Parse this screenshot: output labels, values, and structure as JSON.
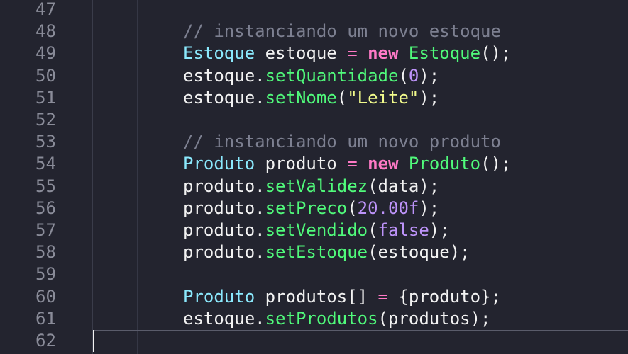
{
  "lines": [
    {
      "n": "47",
      "tokens": []
    },
    {
      "n": "48",
      "tokens": [
        {
          "t": "cmt",
          "v": "// instanciando um novo estoque"
        }
      ]
    },
    {
      "n": "49",
      "tokens": [
        {
          "t": "type",
          "v": "Estoque"
        },
        {
          "t": "plain",
          "v": " estoque "
        },
        {
          "t": "op",
          "v": "="
        },
        {
          "t": "plain",
          "v": " "
        },
        {
          "t": "kw",
          "v": "new"
        },
        {
          "t": "plain",
          "v": " "
        },
        {
          "t": "fn",
          "v": "Estoque"
        },
        {
          "t": "plain",
          "v": "();"
        }
      ]
    },
    {
      "n": "50",
      "tokens": [
        {
          "t": "plain",
          "v": "estoque."
        },
        {
          "t": "fn",
          "v": "setQuantidade"
        },
        {
          "t": "plain",
          "v": "("
        },
        {
          "t": "num",
          "v": "0"
        },
        {
          "t": "plain",
          "v": ");"
        }
      ]
    },
    {
      "n": "51",
      "tokens": [
        {
          "t": "plain",
          "v": "estoque."
        },
        {
          "t": "fn",
          "v": "setNome"
        },
        {
          "t": "plain",
          "v": "("
        },
        {
          "t": "str",
          "v": "\"Leite\""
        },
        {
          "t": "plain",
          "v": ");"
        }
      ]
    },
    {
      "n": "52",
      "tokens": []
    },
    {
      "n": "53",
      "tokens": [
        {
          "t": "cmt",
          "v": "// instanciando um novo produto"
        }
      ]
    },
    {
      "n": "54",
      "tokens": [
        {
          "t": "type",
          "v": "Produto"
        },
        {
          "t": "plain",
          "v": " produto "
        },
        {
          "t": "op",
          "v": "="
        },
        {
          "t": "plain",
          "v": " "
        },
        {
          "t": "kw",
          "v": "new"
        },
        {
          "t": "plain",
          "v": " "
        },
        {
          "t": "fn",
          "v": "Produto"
        },
        {
          "t": "plain",
          "v": "();"
        }
      ]
    },
    {
      "n": "55",
      "tokens": [
        {
          "t": "plain",
          "v": "produto."
        },
        {
          "t": "fn",
          "v": "setValidez"
        },
        {
          "t": "plain",
          "v": "(data);"
        }
      ]
    },
    {
      "n": "56",
      "tokens": [
        {
          "t": "plain",
          "v": "produto."
        },
        {
          "t": "fn",
          "v": "setPreco"
        },
        {
          "t": "plain",
          "v": "("
        },
        {
          "t": "num",
          "v": "20.00f"
        },
        {
          "t": "plain",
          "v": ");"
        }
      ]
    },
    {
      "n": "57",
      "tokens": [
        {
          "t": "plain",
          "v": "produto."
        },
        {
          "t": "fn",
          "v": "setVendido"
        },
        {
          "t": "plain",
          "v": "("
        },
        {
          "t": "num",
          "v": "false"
        },
        {
          "t": "plain",
          "v": ");"
        }
      ]
    },
    {
      "n": "58",
      "tokens": [
        {
          "t": "plain",
          "v": "produto."
        },
        {
          "t": "fn",
          "v": "setEstoque"
        },
        {
          "t": "plain",
          "v": "(estoque);"
        }
      ]
    },
    {
      "n": "59",
      "tokens": []
    },
    {
      "n": "60",
      "tokens": [
        {
          "t": "type",
          "v": "Produto"
        },
        {
          "t": "plain",
          "v": " produtos[] "
        },
        {
          "t": "op",
          "v": "="
        },
        {
          "t": "plain",
          "v": " {produto};"
        }
      ]
    },
    {
      "n": "61",
      "tokens": [
        {
          "t": "plain",
          "v": "estoque."
        },
        {
          "t": "fn",
          "v": "setProdutos"
        },
        {
          "t": "plain",
          "v": "(produtos);"
        }
      ]
    },
    {
      "n": "62",
      "tokens": [],
      "current": true
    }
  ],
  "colors": {
    "background": "#23242f",
    "comment": "#7d8091",
    "type": "#8be9fd",
    "keyword": "#ff79c6",
    "function": "#50fa7b",
    "number": "#bd93f9",
    "string": "#f1fa8c",
    "text": "#f2f2f2",
    "line_number": "#8a8c99"
  }
}
